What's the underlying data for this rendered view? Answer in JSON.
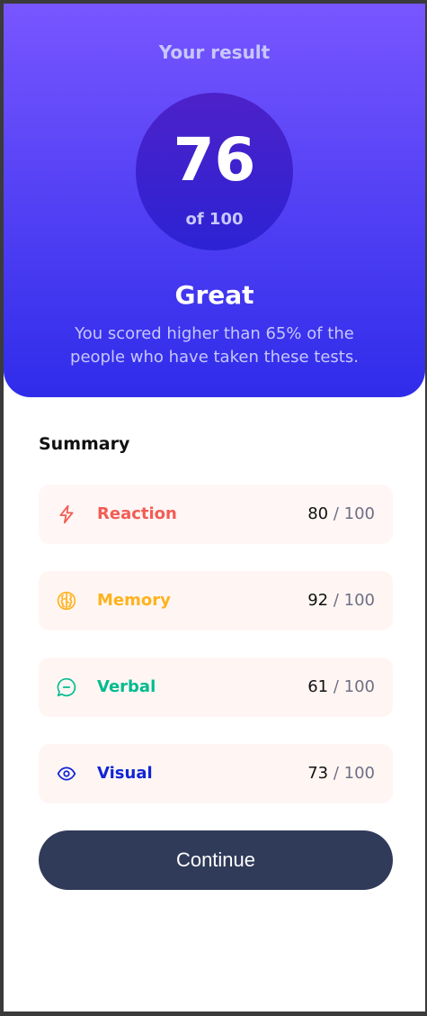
{
  "result": {
    "title": "Your result",
    "score": "76",
    "score_of": "of 100",
    "rating": "Great",
    "message": "You scored higher than 65% of the people who have taken these tests."
  },
  "summary": {
    "title": "Summary",
    "separator": "/",
    "items": [
      {
        "label": "Reaction",
        "score": "80",
        "max": "100",
        "icon": "lightning-icon",
        "color": "#f25c54",
        "bg": "#fff6f5"
      },
      {
        "label": "Memory",
        "score": "92",
        "max": "100",
        "icon": "brain-icon",
        "color": "#ffb21e",
        "bg": "#fffbf2"
      },
      {
        "label": "Verbal",
        "score": "61",
        "max": "100",
        "icon": "chat-bubble-icon",
        "color": "#00bb8f",
        "bg": "#f2fbfa"
      },
      {
        "label": "Visual",
        "score": "73",
        "max": "100",
        "icon": "eye-icon",
        "color": "#1125d6",
        "bg": "#f3f3fd"
      }
    ]
  },
  "continue_label": "Continue",
  "colors": {
    "gradient_top": "#7856ff",
    "gradient_bottom": "#2f2cea",
    "button": "#303b5a"
  }
}
